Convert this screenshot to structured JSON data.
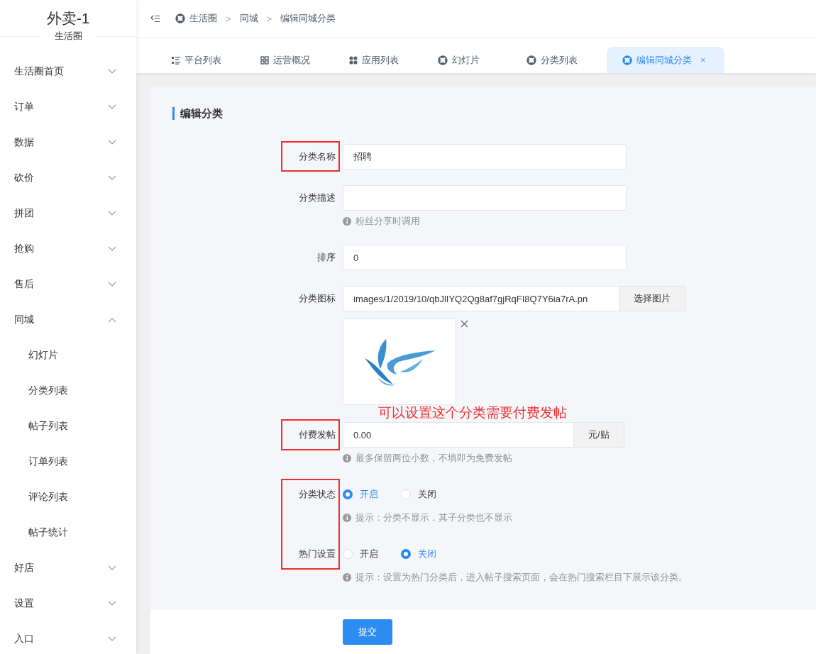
{
  "sidebar": {
    "title": "外卖-1",
    "subtitle": "生活圈",
    "items": [
      {
        "label": "生活圈首页",
        "expanded": false
      },
      {
        "label": "订单",
        "expanded": false
      },
      {
        "label": "数据",
        "expanded": false
      },
      {
        "label": "砍价",
        "expanded": false
      },
      {
        "label": "拼团",
        "expanded": false
      },
      {
        "label": "抢购",
        "expanded": false
      },
      {
        "label": "售后",
        "expanded": false
      },
      {
        "label": "同城",
        "expanded": true,
        "children": [
          {
            "label": "幻灯片"
          },
          {
            "label": "分类列表"
          },
          {
            "label": "帖子列表"
          },
          {
            "label": "订单列表"
          },
          {
            "label": "评论列表"
          },
          {
            "label": "帖子统计"
          }
        ]
      },
      {
        "label": "好店",
        "expanded": false
      },
      {
        "label": "设置",
        "expanded": false
      },
      {
        "label": "入口",
        "expanded": false
      }
    ]
  },
  "breadcrumb": {
    "separator": ">",
    "items": [
      "生活圈",
      "同城",
      "编辑同城分类"
    ]
  },
  "tabs": [
    {
      "label": "平台列表",
      "kind": "list",
      "selected": false
    },
    {
      "label": "运营概况",
      "kind": "grid",
      "selected": false
    },
    {
      "label": "应用列表",
      "kind": "apps",
      "selected": false
    },
    {
      "label": "幻灯片",
      "kind": "ring",
      "selected": false
    },
    {
      "label": "分类列表",
      "kind": "ring",
      "selected": false
    },
    {
      "label": "编辑同城分类",
      "kind": "ring",
      "selected": true,
      "close": "×"
    }
  ],
  "form": {
    "title": "编辑分类",
    "groups": [
      {
        "highlighted": true,
        "fields": [
          {
            "kind": "text",
            "label": "分类名称",
            "value": "招聘"
          }
        ]
      },
      {
        "highlighted": false,
        "fields": [
          {
            "kind": "text",
            "label": "分类描述",
            "hint": "粉丝分享时调用"
          },
          {
            "kind": "text",
            "label": "排序",
            "value": "0"
          },
          {
            "label": "分类图标",
            "value": "images/1/2019/10/qbJlIYQ2Qg8af7gjRqFI8Q7Y6ia7rA.pn",
            "button": "选择图片",
            "note": "可以设置这个分类需要付费发帖"
          }
        ]
      },
      {
        "highlighted": true,
        "fields": [
          {
            "kind": "addon",
            "label": "付费发帖",
            "value": "0.00",
            "suffix": "元/贴",
            "hint": "最多保留两位小数，不填即为免费发帖"
          }
        ]
      },
      {
        "highlighted": true,
        "fields": [
          {
            "kind": "radio",
            "label": "分类状态",
            "options": [
              {
                "label": "开启",
                "selected": true
              },
              {
                "label": "关闭",
                "selected": false
              }
            ],
            "hint": "提示：分类不显示，其子分类也不显示"
          },
          {
            "kind": "radio",
            "label": "热门设置",
            "options": [
              {
                "label": "开启",
                "selected": false
              },
              {
                "label": "关闭",
                "selected": true
              }
            ],
            "hint": "提示：设置为热门分类后，进入帖子搜索页面，会在热门搜索栏目下展示该分类。"
          }
        ]
      }
    ],
    "submit": "提交"
  }
}
